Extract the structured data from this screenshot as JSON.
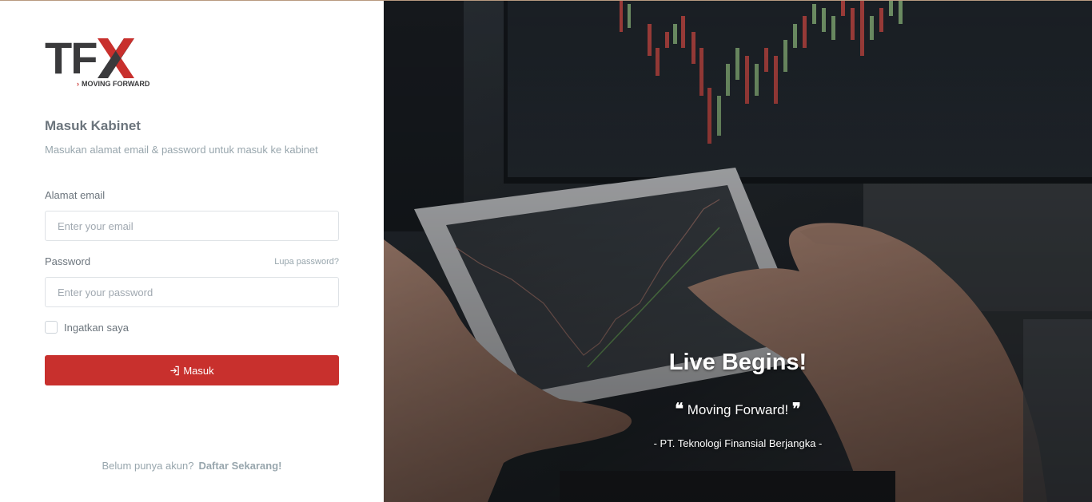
{
  "brand": {
    "logo_text_1": "TF",
    "logo_text_2": "X",
    "tagline": "MOVING FORWARD",
    "accent_color": "#c8302d",
    "dark_color": "#3a3a3c"
  },
  "login": {
    "title": "Masuk Kabinet",
    "subtitle": "Masukan alamat email & password untuk masuk ke kabinet",
    "email_label": "Alamat email",
    "email_placeholder": "Enter your email",
    "email_value": "",
    "password_label": "Password",
    "forgot_label": "Lupa password?",
    "password_placeholder": "Enter your password",
    "password_value": "",
    "remember_label": "Ingatkan saya",
    "remember_checked": false,
    "submit_label": "Masuk",
    "submit_icon": "login-icon"
  },
  "signup": {
    "prompt": "Belum punya akun?",
    "link_label": "Daftar Sekarang!"
  },
  "hero": {
    "title": "Live Begins!",
    "open_quote": "❝",
    "quote": "Moving Forward!",
    "close_quote": "❞",
    "company": "- PT. Teknologi Finansial Berjangka -"
  }
}
